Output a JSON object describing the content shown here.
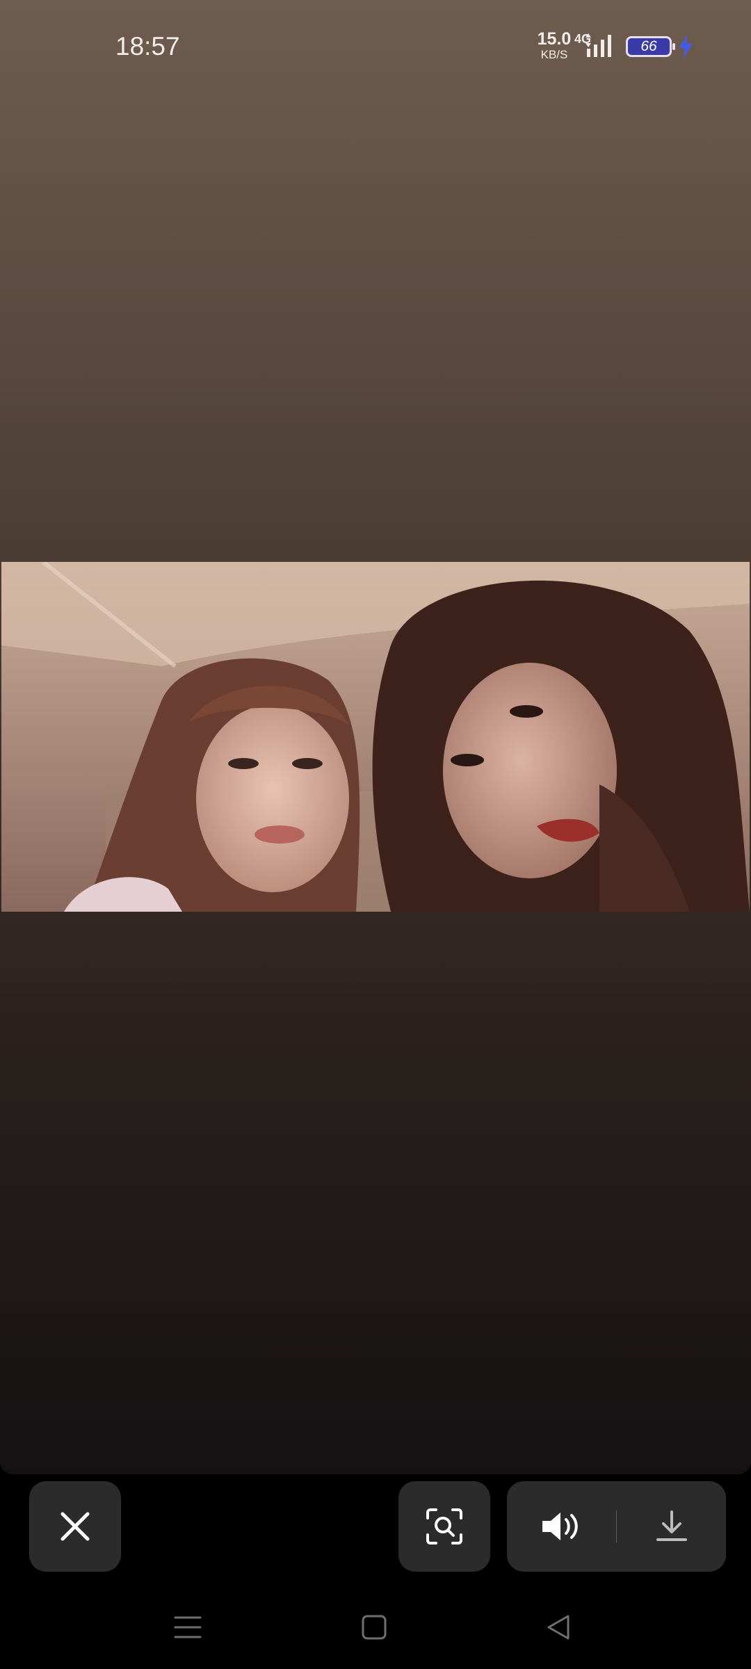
{
  "status_bar": {
    "time": "18:57",
    "net_speed_value": "15.0",
    "net_speed_unit": "KB/S",
    "network_type": "4G",
    "battery_level": "66",
    "charging": true
  },
  "media": {
    "content": "photo",
    "icon": "image-viewer"
  },
  "controls": {
    "close_icon": "close-icon",
    "scan_icon": "visual-search-icon",
    "sound_icon": "volume-on-icon",
    "download_icon": "download-icon"
  },
  "navigation": {
    "recent_icon": "menu-icon",
    "home_icon": "home-square-icon",
    "back_icon": "back-triangle-icon"
  },
  "colors": {
    "accent_battery": "#3a3aa8",
    "button_bg": "#2b2b2b"
  }
}
